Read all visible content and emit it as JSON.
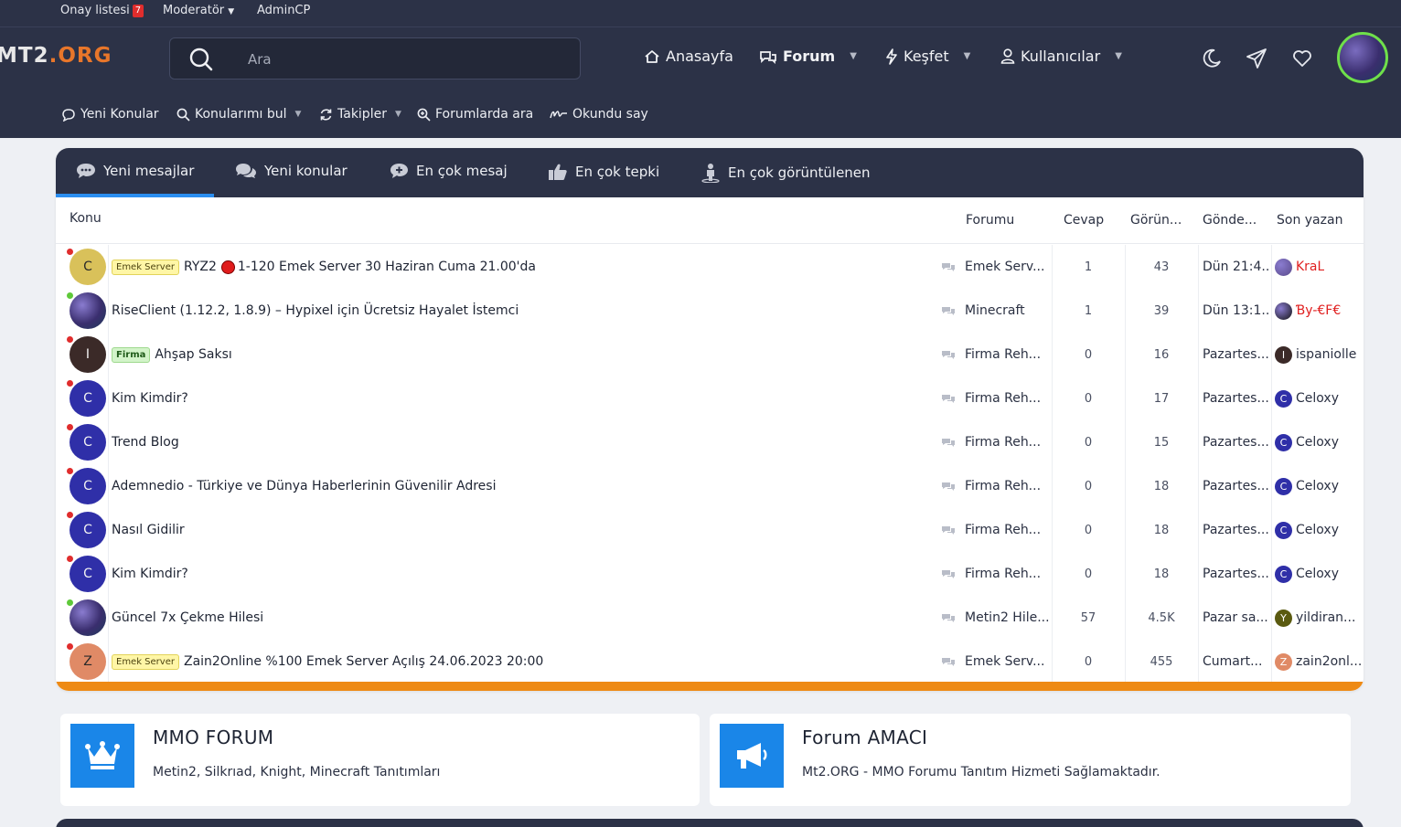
{
  "topbar": {
    "approval_label": "Onay listesi",
    "approval_count": "7",
    "moderator_label": "Moderatör",
    "admincp_label": "AdminCP"
  },
  "header": {
    "logo_left": "MT2",
    "logo_right": ".ORG",
    "search_placeholder": "Ara",
    "nav": {
      "home": "Anasayfa",
      "forum": "Forum",
      "discover": "Keşfet",
      "users": "Kullanıcılar"
    }
  },
  "subnav": {
    "new_topics": "Yeni Konular",
    "find_my_topics": "Konularımı bul",
    "follows": "Takipler",
    "search_forums": "Forumlarda ara",
    "mark_read": "Okundu say"
  },
  "tabs": [
    {
      "label": "Yeni mesajlar"
    },
    {
      "label": "Yeni konular"
    },
    {
      "label": "En çok mesaj"
    },
    {
      "label": "En çok tepki"
    },
    {
      "label": "En çok görüntülenen"
    }
  ],
  "table": {
    "headers": {
      "topic": "Konu",
      "forum": "Forumu",
      "replies": "Cevap",
      "views": "Görün...",
      "posted": "Gönde...",
      "last_poster": "Son yazan"
    },
    "rows": [
      {
        "avatar": "C",
        "avatar_color": "#d9c15a",
        "status": "#e02d2d",
        "prefix": "Emek Server",
        "prefix_type": "emek",
        "has_red_circle": true,
        "title_a": "RYZ2",
        "title_b": "1-120 Emek Server 30 Haziran Cuma 21.00'da",
        "forum": "Emek Serv...",
        "replies": "1",
        "views": "43",
        "date": "Dün 21:4...",
        "last": "KraL",
        "last_color": "#e02020",
        "last_av": "",
        "last_av_color": "#5a4a8a"
      },
      {
        "avatar": "",
        "avatar_color": "#4a3e7e",
        "status": "#5fc93a",
        "prefix": "",
        "prefix_type": "",
        "has_red_circle": false,
        "title_a": "",
        "title_b": "RiseClient (1.12.2, 1.8.9) – Hypixel için Ücretsiz Hayalet İstemci",
        "forum": "Minecraft",
        "replies": "1",
        "views": "39",
        "date": "Dün 13:1...",
        "last": "Ɓy-€F€",
        "last_color": "#e02020",
        "last_av": "",
        "last_av_color": "#111111"
      },
      {
        "avatar": "I",
        "avatar_color": "#3b2a28",
        "status": "#e02d2d",
        "prefix": "Firma",
        "prefix_type": "firma",
        "has_red_circle": false,
        "title_a": "",
        "title_b": "Ahşap Saksı",
        "forum": "Firma Reh...",
        "replies": "0",
        "views": "16",
        "date": "Pazartes...",
        "last": "ispaniolle",
        "last_color": "#2a3042",
        "last_av": "I",
        "last_av_color": "#3b2a28"
      },
      {
        "avatar": "C",
        "avatar_color": "#2f2fa8",
        "status": "#e02d2d",
        "prefix": "",
        "prefix_type": "",
        "has_red_circle": false,
        "title_a": "",
        "title_b": "Kim Kimdir?",
        "forum": "Firma Reh...",
        "replies": "0",
        "views": "17",
        "date": "Pazartes...",
        "last": "Celoxy",
        "last_color": "#2a3042",
        "last_av": "C",
        "last_av_color": "#2f2fa8"
      },
      {
        "avatar": "C",
        "avatar_color": "#2f2fa8",
        "status": "#e02d2d",
        "prefix": "",
        "prefix_type": "",
        "has_red_circle": false,
        "title_a": "",
        "title_b": "Trend Blog",
        "forum": "Firma Reh...",
        "replies": "0",
        "views": "15",
        "date": "Pazartes...",
        "last": "Celoxy",
        "last_color": "#2a3042",
        "last_av": "C",
        "last_av_color": "#2f2fa8"
      },
      {
        "avatar": "C",
        "avatar_color": "#2f2fa8",
        "status": "#e02d2d",
        "prefix": "",
        "prefix_type": "",
        "has_red_circle": false,
        "title_a": "",
        "title_b": "Ademnedio - Türkiye ve Dünya Haberlerinin Güvenilir Adresi",
        "forum": "Firma Reh...",
        "replies": "0",
        "views": "18",
        "date": "Pazartes...",
        "last": "Celoxy",
        "last_color": "#2a3042",
        "last_av": "C",
        "last_av_color": "#2f2fa8"
      },
      {
        "avatar": "C",
        "avatar_color": "#2f2fa8",
        "status": "#e02d2d",
        "prefix": "",
        "prefix_type": "",
        "has_red_circle": false,
        "title_a": "",
        "title_b": "Nasıl Gidilir",
        "forum": "Firma Reh...",
        "replies": "0",
        "views": "18",
        "date": "Pazartes...",
        "last": "Celoxy",
        "last_color": "#2a3042",
        "last_av": "C",
        "last_av_color": "#2f2fa8"
      },
      {
        "avatar": "C",
        "avatar_color": "#2f2fa8",
        "status": "#e02d2d",
        "prefix": "",
        "prefix_type": "",
        "has_red_circle": false,
        "title_a": "",
        "title_b": "Kim Kimdir?",
        "forum": "Firma Reh...",
        "replies": "0",
        "views": "18",
        "date": "Pazartes...",
        "last": "Celoxy",
        "last_color": "#2a3042",
        "last_av": "C",
        "last_av_color": "#2f2fa8"
      },
      {
        "avatar": "",
        "avatar_color": "#4a3e7e",
        "status": "#5fc93a",
        "prefix": "",
        "prefix_type": "",
        "has_red_circle": false,
        "title_a": "",
        "title_b": "Güncel 7x Çekme Hilesi",
        "forum": "Metin2 Hile...",
        "replies": "57",
        "views": "4.5K",
        "date": "Pazar sa...",
        "last": "yildiran...",
        "last_color": "#2a3042",
        "last_av": "Y",
        "last_av_color": "#5a5a10"
      },
      {
        "avatar": "Z",
        "avatar_color": "#e08a66",
        "status": "#e02d2d",
        "prefix": "Emek Server",
        "prefix_type": "emek",
        "has_red_circle": false,
        "title_a": "",
        "title_b": "Zain2Online %100 Emek Server Açılış 24.06.2023 20:00",
        "forum": "Emek Serv...",
        "replies": "0",
        "views": "455",
        "date": "Cumart...",
        "last": "zain2onl...",
        "last_color": "#2a3042",
        "last_av": "Z",
        "last_av_color": "#e08a66"
      }
    ]
  },
  "boxes": [
    {
      "title": "MMO FORUM",
      "desc": "Metin2, Silkrıad, Knight, Minecraft Tanıtımları",
      "icon": "crown-icon"
    },
    {
      "title": "Forum AMACI",
      "desc": "Mt2.ORG - MMO Forumu Tanıtım Hizmeti Sağlamaktadır.",
      "icon": "megaphone-icon"
    }
  ],
  "colors": {
    "header_bg": "#2c3247",
    "accent_blue": "#2b8ef0",
    "accent_orange": "#ee8a14",
    "online": "#5fc93a",
    "offline": "#e02d2d"
  }
}
